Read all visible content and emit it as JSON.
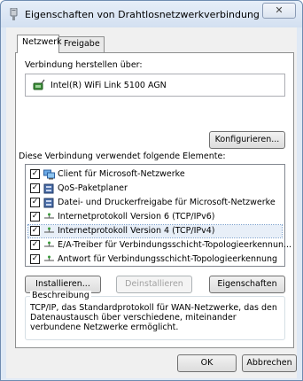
{
  "window": {
    "title": "Eigenschaften von Drahtlosnetzwerkverbindung",
    "close_label": "✕"
  },
  "tabs": [
    {
      "label": "Netzwerk"
    },
    {
      "label": "Freigabe"
    }
  ],
  "connection": {
    "label": "Verbindung herstellen über:",
    "adapter": "Intel(R) WiFi Link 5100 AGN",
    "configure_button": "Konfigurieren..."
  },
  "elements": {
    "label": "Diese Verbindung verwendet folgende Elemente:",
    "items": [
      {
        "label": "Client für Microsoft-Netzwerke",
        "checked": true,
        "icon": "network-client-icon"
      },
      {
        "label": "QoS-Paketplaner",
        "checked": true,
        "icon": "service-icon"
      },
      {
        "label": "Datei- und Druckerfreigabe für Microsoft-Netzwerke",
        "checked": true,
        "icon": "service-icon"
      },
      {
        "label": "Internetprotokoll Version 6 (TCP/IPv6)",
        "checked": true,
        "icon": "protocol-icon"
      },
      {
        "label": "Internetprotokoll Version 4 (TCP/IPv4)",
        "checked": true,
        "icon": "protocol-icon",
        "selected": true
      },
      {
        "label": "E/A-Treiber für Verbindungsschicht-Topologieerkennun...",
        "checked": true,
        "icon": "protocol-icon"
      },
      {
        "label": "Antwort für Verbindungsschicht-Topologieerkennung",
        "checked": true,
        "icon": "protocol-icon"
      }
    ],
    "check_mark": "✓"
  },
  "actions": {
    "install": "Installieren...",
    "uninstall": "Deinstallieren",
    "properties": "Eigenschaften"
  },
  "description": {
    "legend": "Beschreibung",
    "text": "TCP/IP, das Standardprotokoll für WAN-Netzwerke, das den Datenaustausch über verschiedene, miteinander verbundene Netzwerke ermöglicht."
  },
  "footer": {
    "ok": "OK",
    "cancel": "Abbrechen"
  },
  "colors": {
    "title_bar": "#dfe9f5",
    "selection": "#e8eff8",
    "disabled_text": "#a0a0a0"
  }
}
